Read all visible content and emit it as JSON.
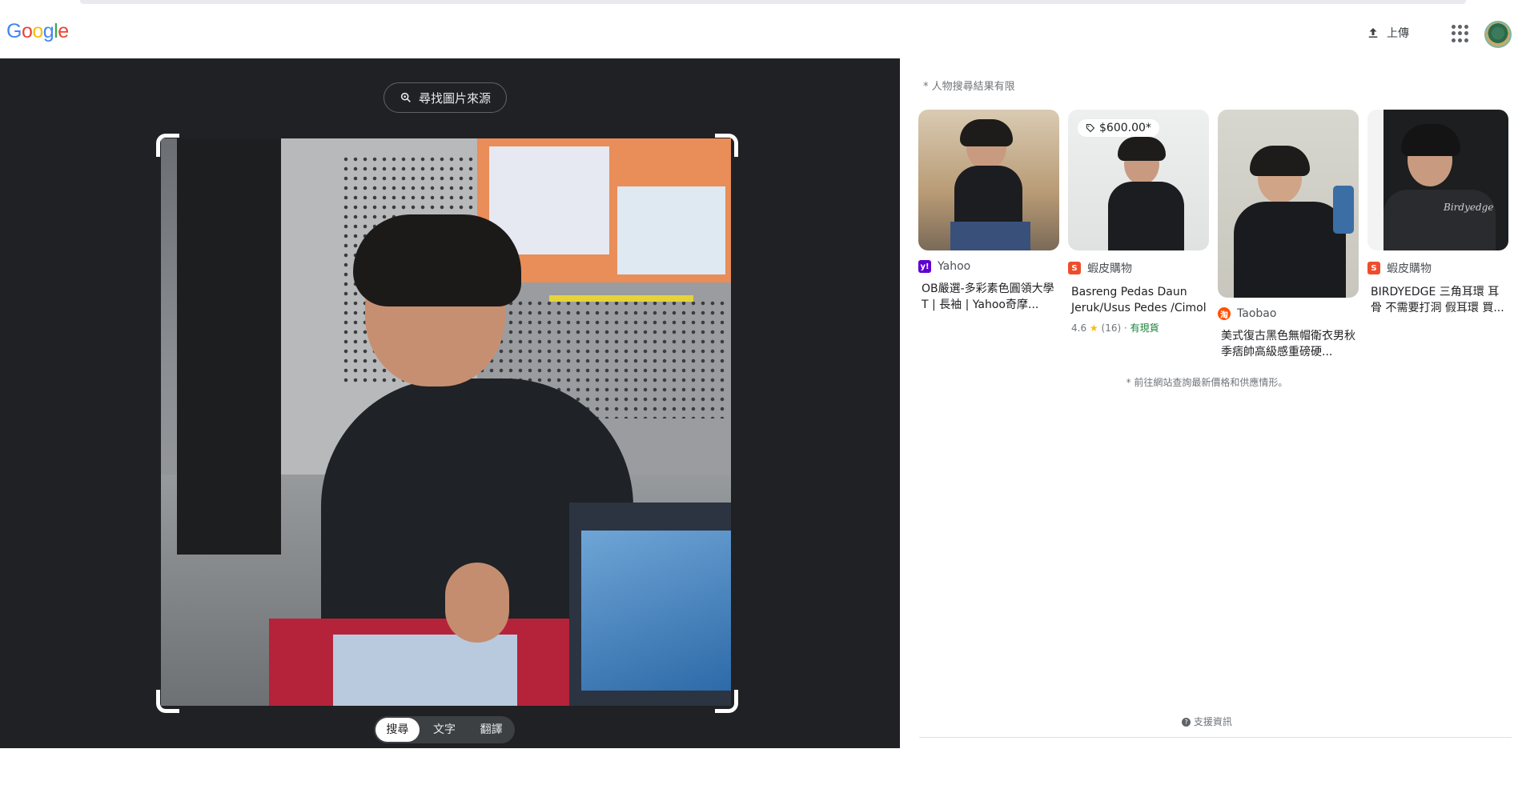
{
  "header": {
    "logo": "Google",
    "upload_label": "上傳",
    "apps_icon": "apps-grid-icon",
    "avatar_icon": "account-avatar"
  },
  "lens": {
    "find_source_label": "尋找圖片來源",
    "modes": [
      "搜尋",
      "文字",
      "翻譯"
    ],
    "active_mode": "搜尋"
  },
  "results": {
    "notice": "* 人物搜尋結果有限",
    "cards": [
      {
        "source": "Yahoo",
        "source_color": "#6001d2",
        "source_glyph": "y!",
        "title": "OB嚴選-多彩素色圓領大學T | 長袖 | Yahoo奇摩..."
      },
      {
        "source": "蝦皮購物",
        "source_color": "#ee4d2d",
        "source_glyph": "S",
        "title": "Basreng Pedas Daun Jeruk/Usus Pedes /Cimol",
        "price": "$600.00*",
        "rating": "4.6",
        "reviews": "(16)",
        "stock": "有現貨"
      },
      {
        "source": "Taobao",
        "source_color": "#ff5000",
        "source_glyph": "淘",
        "title": "美式復古黑色無帽衛衣男秋季痞帥高級感重磅硬..."
      },
      {
        "source": "蝦皮購物",
        "source_color": "#ee4d2d",
        "source_glyph": "S",
        "title": "BIRDYEDGE 三角耳環 耳骨 不需要打洞 假耳環 買..."
      }
    ],
    "footnote": "* 前往網站查詢最新價格和供應情形。",
    "support_label": "支援資訊"
  }
}
